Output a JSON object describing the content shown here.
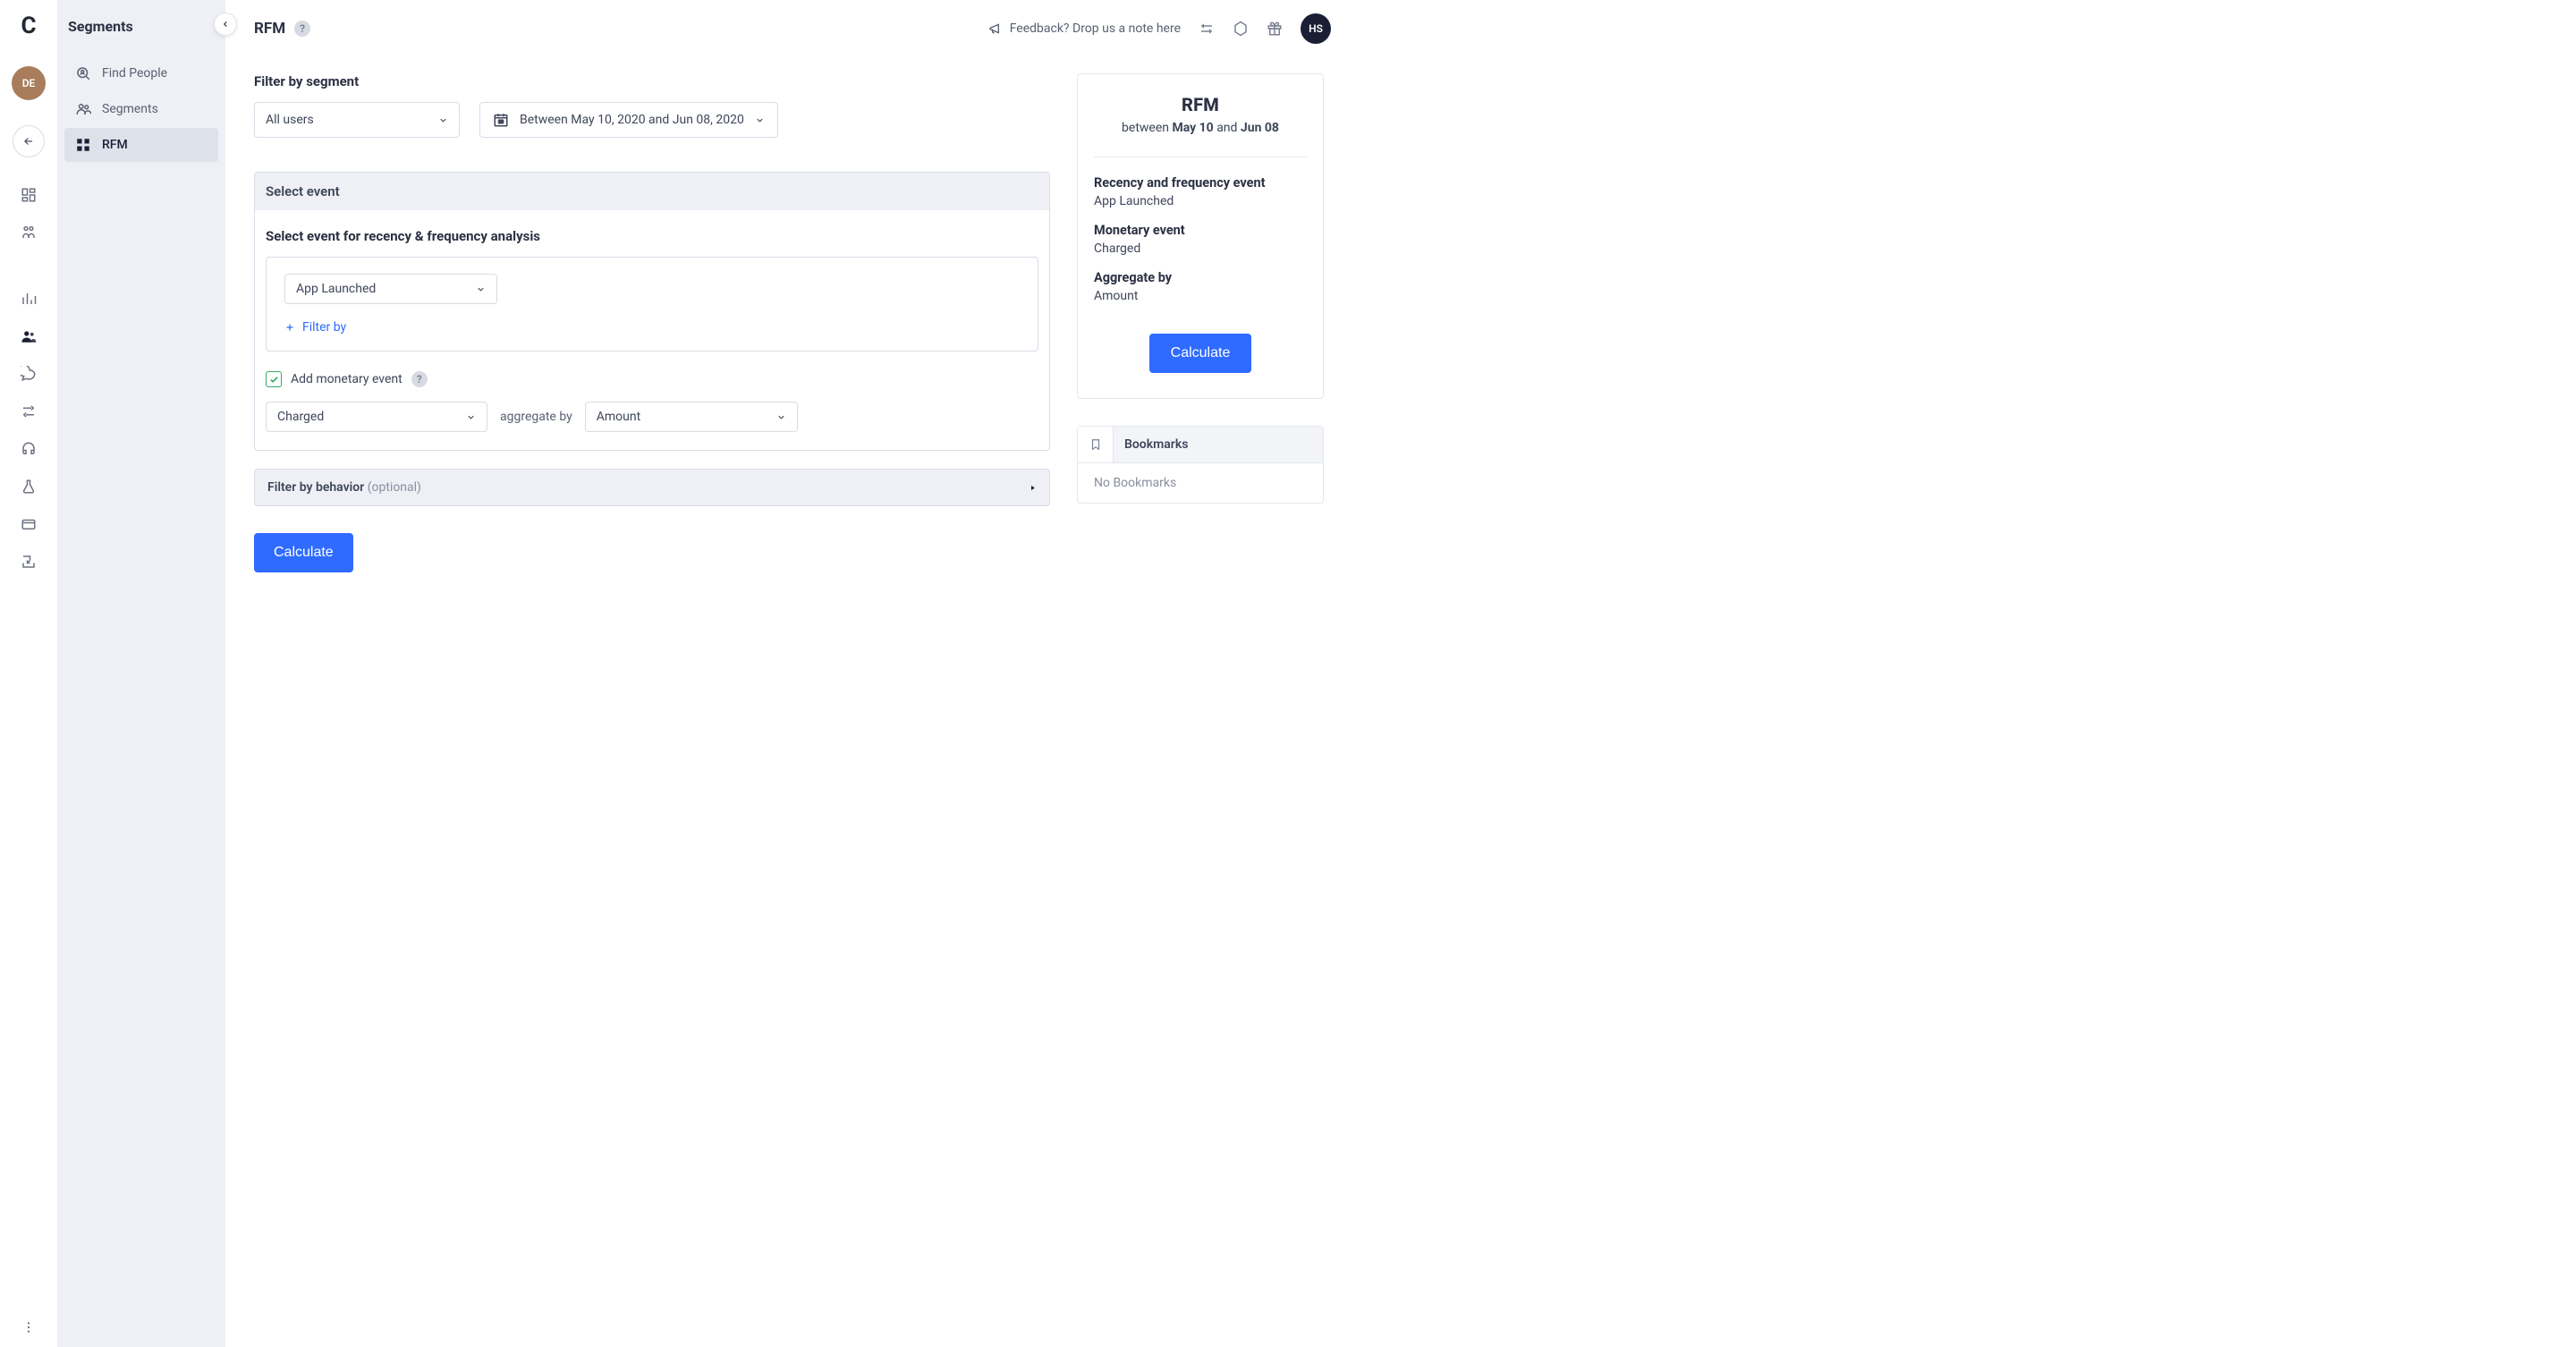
{
  "brand": "C",
  "avatar_rail": "DE",
  "sidebar": {
    "title": "Segments",
    "items": [
      {
        "label": "Find People"
      },
      {
        "label": "Segments"
      },
      {
        "label": "RFM"
      }
    ]
  },
  "topbar": {
    "title": "RFM",
    "feedback": "Feedback? Drop us a note here",
    "avatar": "HS"
  },
  "filter": {
    "label": "Filter by segment",
    "segment": "All users",
    "date_range": "Between May 10, 2020 and Jun 08, 2020"
  },
  "event_panel": {
    "header": "Select event",
    "sublabel": "Select event for recency & frequency analysis",
    "rf_event": "App Launched",
    "filter_by": "Filter by",
    "monetary_checkbox_label": "Add monetary event",
    "monetary_event": "Charged",
    "aggregate_by_label": "aggregate by",
    "aggregate_by_value": "Amount"
  },
  "behavior": {
    "label": "Filter by behavior",
    "optional": "(optional)"
  },
  "calculate_label": "Calculate",
  "summary": {
    "title": "RFM",
    "between_prefix": "between ",
    "date1": "May 10",
    "and": " and ",
    "date2": "Jun 08",
    "rf_event_key": "Recency and frequency event",
    "rf_event_val": "App Launched",
    "m_event_key": "Monetary event",
    "m_event_val": "Charged",
    "agg_key": "Aggregate by",
    "agg_val": "Amount",
    "calculate": "Calculate"
  },
  "bookmarks": {
    "title": "Bookmarks",
    "empty": "No Bookmarks"
  }
}
